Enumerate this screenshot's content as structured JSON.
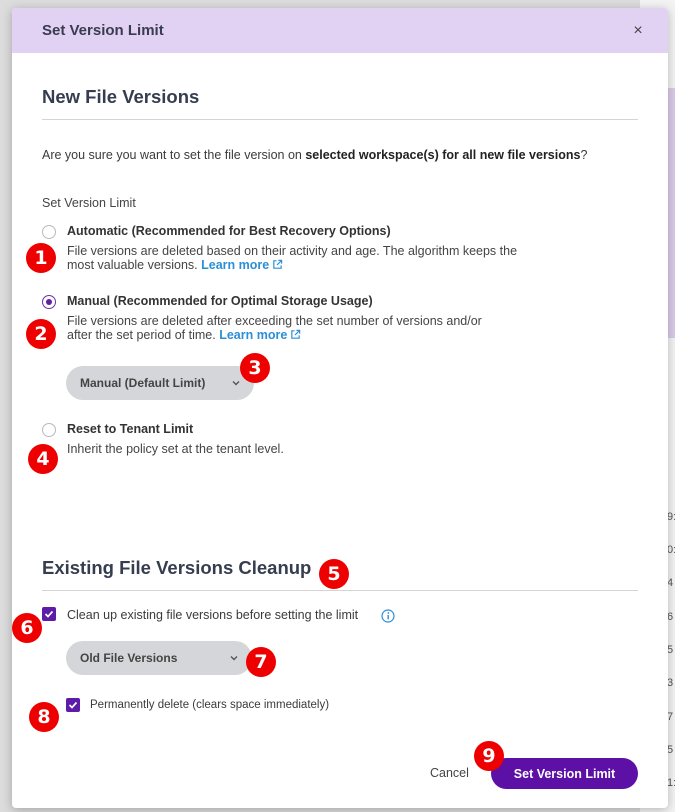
{
  "dialog": {
    "title": "Set Version Limit",
    "close_glyph": "×"
  },
  "new_versions": {
    "title": "New File Versions",
    "confirm_prefix": "Are you sure you want to set the file version on ",
    "confirm_bold": "selected workspace(s) for all new file versions",
    "confirm_suffix": "?",
    "field_label": "Set Version Limit",
    "options": [
      {
        "label": "Automatic (Recommended for Best Recovery Options)",
        "desc": "File versions are deleted based on their activity and age. The algorithm keeps the most valuable versions.",
        "learn_more": "Learn more",
        "selected": false
      },
      {
        "label": "Manual (Recommended for Optimal Storage Usage)",
        "desc": "File versions are deleted after exceeding the set number of versions and/or after the set period of time.",
        "learn_more": "Learn more",
        "selected": true
      },
      {
        "label": "Reset to Tenant Limit",
        "desc": "Inherit the policy set at the tenant level.",
        "selected": false
      }
    ],
    "manual_select_value": "Manual (Default Limit)"
  },
  "cleanup": {
    "title": "Existing File Versions Cleanup",
    "cleanup_checkbox_label": "Clean up existing file versions before setting the limit",
    "cleanup_checked": true,
    "cleanup_select_value": "Old File Versions",
    "permanent_checkbox_label": "Permanently delete (clears space immediately)",
    "permanent_checked": true
  },
  "footer": {
    "cancel_label": "Cancel",
    "submit_label": "Set Version Limit"
  },
  "markers": [
    "1",
    "2",
    "3",
    "4",
    "5",
    "6",
    "7",
    "8",
    "9"
  ],
  "background_numbers": [
    "9:",
    "0:",
    "4",
    "6",
    "5",
    "3",
    "7",
    "5",
    "1:"
  ],
  "colors": {
    "header_bg": "#e1d2f3",
    "accent": "#5c10a6",
    "link": "#2b8fd6",
    "marker": "#ee0000"
  }
}
